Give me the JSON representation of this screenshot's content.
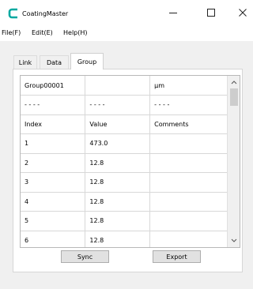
{
  "window": {
    "title": "CoatingMaster"
  },
  "menu": {
    "file": "File(F)",
    "edit": "Edit(E)",
    "help": "Help(H)"
  },
  "tabs": [
    {
      "label": "Link"
    },
    {
      "label": "Data"
    },
    {
      "label": "Group",
      "active": true
    }
  ],
  "table": {
    "rows": [
      [
        "Group00001",
        "",
        "µm"
      ],
      [
        "- - - -",
        "- - - -",
        "- - - -"
      ],
      [
        "Index",
        "Value",
        "Comments"
      ],
      [
        "1",
        "473.0",
        ""
      ],
      [
        "2",
        "12.8",
        ""
      ],
      [
        "3",
        "12.8",
        ""
      ],
      [
        "4",
        "12.8",
        ""
      ],
      [
        "5",
        "12.8",
        ""
      ],
      [
        "6",
        "12.8",
        ""
      ]
    ]
  },
  "buttons": {
    "sync": "Sync",
    "export": "Export"
  },
  "colors": {
    "logo": "#00a8a0",
    "client_bg": "#f0f0f0",
    "button_bg": "#e1e1e1"
  }
}
